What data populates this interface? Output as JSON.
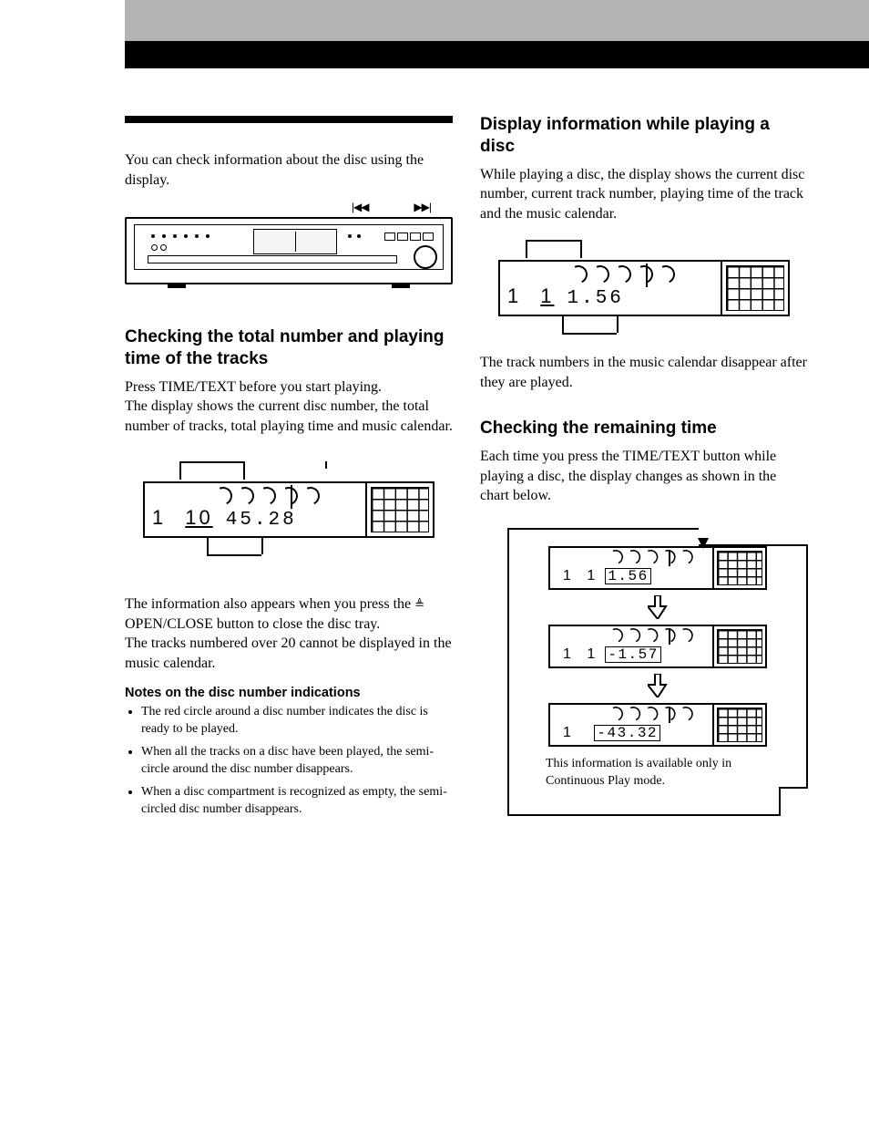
{
  "intro_para": "You can check information about the disc using the display.",
  "controls": {
    "prev": "|◀◀",
    "next": "▶▶|"
  },
  "sec1": {
    "heading": "Checking the total number and playing time of the tracks",
    "p1": "Press TIME/TEXT before you start playing.\nThe display shows the current disc number, the total number of tracks, total playing time and music calendar.",
    "p2a": "The information also appears when you press the ",
    "p2b": " OPEN/CLOSE button to close the disc tray.\nThe tracks numbered over 20 cannot be displayed in the music calendar.",
    "notes_heading": "Notes on the disc number indications",
    "notes": [
      "The red circle around a disc number indicates the disc is ready to be played.",
      "When all the tracks on a disc have been played, the semi-circle around the disc number disappears.",
      "When a disc compartment is recognized as empty, the semi-circled disc number disappears."
    ]
  },
  "display1": {
    "disc": "1",
    "tracks": "10",
    "time": "45.28"
  },
  "right": {
    "h1": "Display information while playing a disc",
    "p1": "While playing a disc, the display shows the current disc number, current track number, playing time of the track and the music calendar.",
    "p2": "The track numbers in the music calendar disappear after they are played.",
    "h2": "Checking the remaining time",
    "p3": "Each time you press the TIME/TEXT button while playing a disc, the display changes as shown in the chart below."
  },
  "display2": {
    "disc": "1",
    "track": "1",
    "time": "1.56"
  },
  "flow": {
    "a": {
      "disc": "1",
      "track": "1",
      "time": "1.56"
    },
    "b": {
      "disc": "1",
      "track": "1",
      "time": "-1.57"
    },
    "c": {
      "disc": "1",
      "track": "",
      "time": "-43.32"
    },
    "note": "This information is available only in Continuous Play mode."
  }
}
